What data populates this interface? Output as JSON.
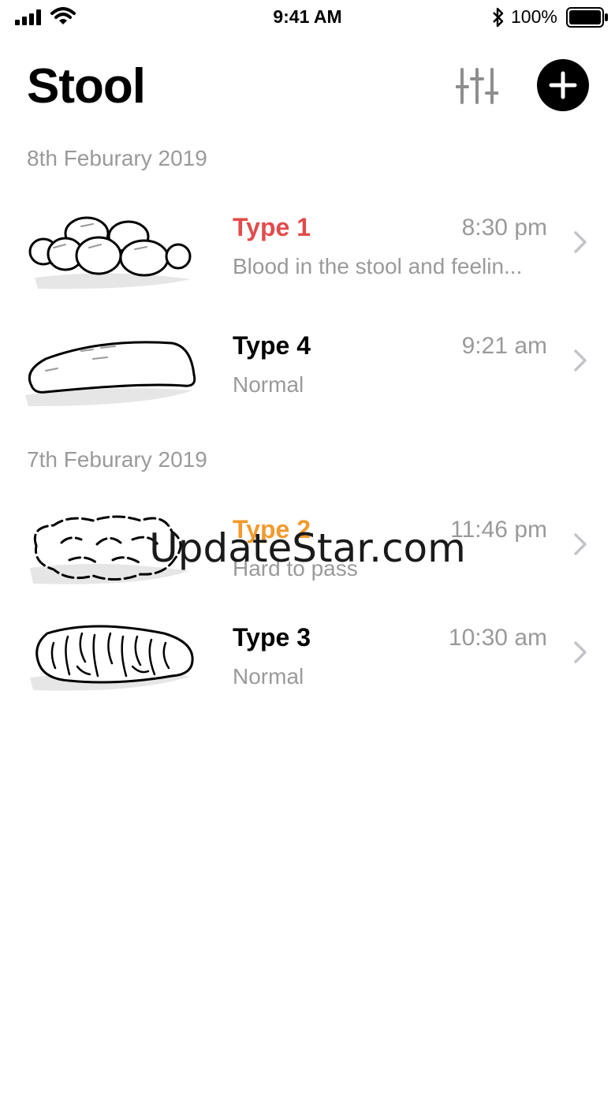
{
  "status_bar": {
    "time": "9:41 AM",
    "battery": "100%"
  },
  "header": {
    "title": "Stool"
  },
  "sections": [
    {
      "date": "8th Feburary 2019",
      "entries": [
        {
          "type": "Type 1",
          "time": "8:30 pm",
          "note": "Blood in the stool and feelin...",
          "color": "#e24b4b"
        },
        {
          "type": "Type 4",
          "time": "9:21 am",
          "note": "Normal",
          "color": "#000000"
        }
      ]
    },
    {
      "date": "7th Feburary 2019",
      "entries": [
        {
          "type": "Type 2",
          "time": "11:46 pm",
          "note": "Hard to pass",
          "color": "#f29a2e"
        },
        {
          "type": "Type 3",
          "time": "10:30 am",
          "note": "Normal",
          "color": "#000000"
        }
      ]
    }
  ],
  "watermark": "UpdateStar.com"
}
